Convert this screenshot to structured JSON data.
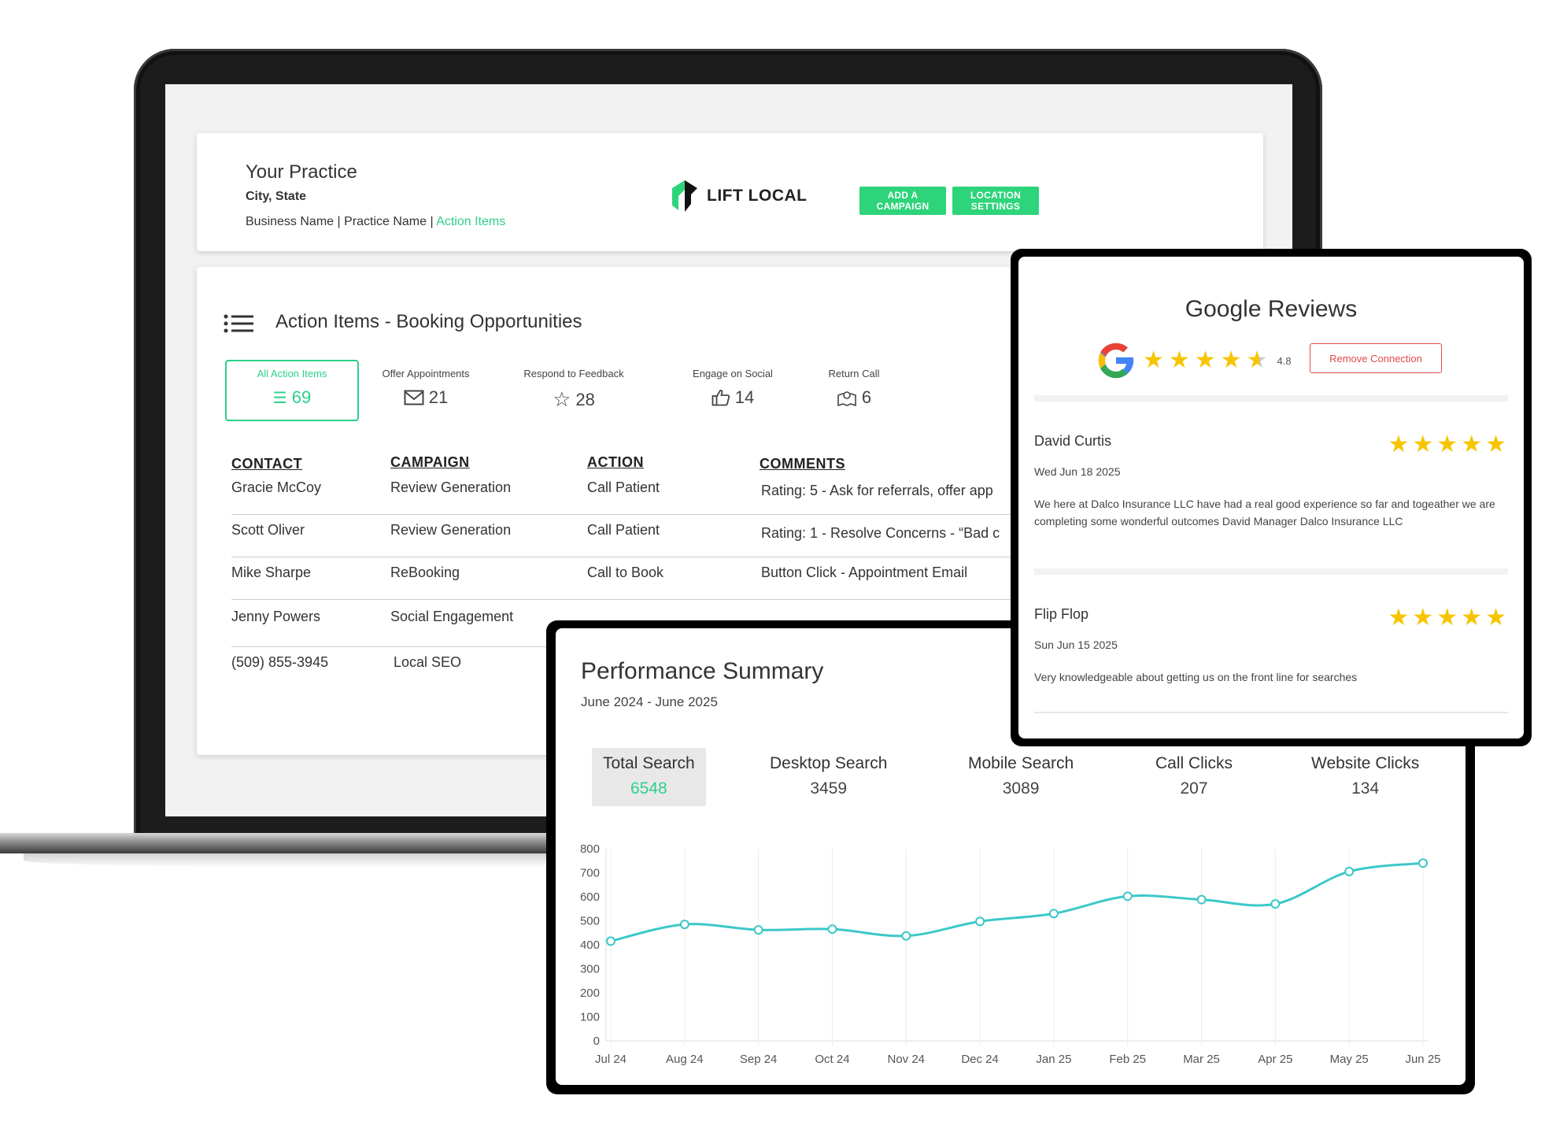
{
  "header": {
    "practice_name": "Your Practice",
    "city_state": "City, State",
    "breadcrumb_business": "Business Name",
    "breadcrumb_practice": "Practice Name",
    "breadcrumb_active": "Action Items",
    "breadcrumb_sep": "|",
    "logo_text": "LIFT LOCAL",
    "add_campaign_label": "ADD A CAMPAIGN",
    "location_settings_label": "LOCATION SETTINGS"
  },
  "action_items": {
    "title": "Action Items - Booking Opportunities",
    "metrics": [
      {
        "label": "All Action Items",
        "value": "69",
        "icon": "list-icon"
      },
      {
        "label": "Offer Appointments",
        "value": "21",
        "icon": "mail-icon"
      },
      {
        "label": "Respond to Feedback",
        "value": "28",
        "icon": "star-outline-icon"
      },
      {
        "label": "Engage on Social",
        "value": "14",
        "icon": "thumbs-up-icon"
      },
      {
        "label": "Return Call",
        "value": "6",
        "icon": "map-pin-icon"
      }
    ],
    "columns": [
      "CONTACT",
      "CAMPAIGN",
      "ACTION",
      "COMMENTS"
    ],
    "rows": [
      {
        "contact": "Gracie McCoy",
        "campaign": "Review Generation",
        "action": "Call Patient",
        "comments": "Rating: 5 - Ask for referrals, offer app"
      },
      {
        "contact": "Scott Oliver",
        "campaign": "Review Generation",
        "action": "Call Patient",
        "comments": "Rating: 1 - Resolve Concerns - “Bad c"
      },
      {
        "contact": "Mike Sharpe",
        "campaign": "ReBooking",
        "action": "Call to Book",
        "comments": "Button Click - Appointment Email"
      },
      {
        "contact": "Jenny Powers",
        "campaign": "Social Engagement",
        "action": "",
        "comments": ""
      },
      {
        "contact": "(509) 855-3945",
        "campaign": "Local SEO",
        "action": "",
        "comments": ""
      }
    ]
  },
  "reviews": {
    "title": "Google Reviews",
    "rating": "4.8",
    "rating_value": 4.8,
    "remove_label": "Remove Connection",
    "items": [
      {
        "name": "David Curtis",
        "date": "Wed Jun 18 2025",
        "stars": 5,
        "text": "We here at Dalco Insurance LLC have had a real good experience so far and togeather we are completing some wonderful outcomes David Manager Dalco Insurance LLC"
      },
      {
        "name": "Flip Flop",
        "date": "Sun Jun 15 2025",
        "stars": 5,
        "text": "Very knowledgeable about getting us on the front line for searches"
      }
    ]
  },
  "performance": {
    "title": "Performance Summary",
    "date_range": "June 2024 - June 2025",
    "stats": [
      {
        "label": "Total Search",
        "value": "6548"
      },
      {
        "label": "Desktop Search",
        "value": "3459"
      },
      {
        "label": "Mobile Search",
        "value": "3089"
      },
      {
        "label": "Call Clicks",
        "value": "207"
      },
      {
        "label": "Website Clicks",
        "value": "134"
      }
    ]
  },
  "chart_data": {
    "type": "line",
    "title": "",
    "xlabel": "",
    "ylabel": "",
    "categories": [
      "Jul 24",
      "Aug 24",
      "Sep 24",
      "Oct 24",
      "Nov 24",
      "Dec 24",
      "Jan 25",
      "Feb 25",
      "Mar 25",
      "Apr 25",
      "May 25",
      "Jun 25"
    ],
    "series": [
      {
        "values": [
          415,
          485,
          462,
          465,
          437,
          497,
          530,
          602,
          588,
          570,
          705,
          740
        ]
      }
    ],
    "ylim": [
      0,
      800
    ],
    "yticks": [
      0,
      100,
      200,
      300,
      400,
      500,
      600,
      700,
      800
    ],
    "grid": "vertical",
    "color": "#3cc8c8"
  },
  "colors": {
    "accent": "#2ecf8b",
    "button_green": "#2ed47a",
    "star": "#f7c500",
    "danger": "#e04a4a"
  }
}
